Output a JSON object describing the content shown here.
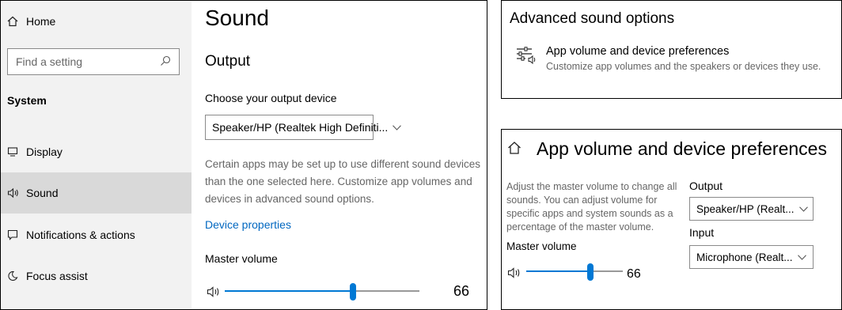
{
  "settings": {
    "sidebar": {
      "home_label": "Home",
      "search_placeholder": "Find a setting",
      "section_label": "System",
      "items": [
        {
          "label": "Display",
          "icon": "monitor-icon"
        },
        {
          "label": "Sound",
          "icon": "speaker-icon",
          "active": true
        },
        {
          "label": "Notifications & actions",
          "icon": "notification-icon"
        },
        {
          "label": "Focus assist",
          "icon": "moon-icon"
        }
      ]
    },
    "main": {
      "title": "Sound",
      "section": "Output",
      "device_label": "Choose your output device",
      "device_value": "Speaker/HP (Realtek High Definiti...",
      "note": "Certain apps may be set up to use different sound devices than the one selected here. Customize app volumes and devices in advanced sound options.",
      "device_properties_link": "Device properties",
      "master_label": "Master volume",
      "master_value": "66",
      "master_fraction": 0.66
    }
  },
  "advanced": {
    "title": "Advanced sound options",
    "item_title": "App volume and device preferences",
    "item_subtitle": "Customize app volumes and the speakers or devices they use.",
    "item_icon": "sliders-speaker-icon"
  },
  "app_volume": {
    "title": "App volume and device preferences",
    "description": "Adjust the master volume to change all sounds. You can adjust volume for specific apps and system sounds as a percentage of the master volume.",
    "master_label": "Master volume",
    "master_value": "66",
    "master_fraction": 0.66,
    "output_label": "Output",
    "output_value": "Speaker/HP (Realt...",
    "input_label": "Input",
    "input_value": "Microphone (Realt..."
  },
  "colors": {
    "accent": "#0078d4",
    "link": "#0067c0",
    "sidebar_bg": "#f2f2f2",
    "sidebar_active": "#d9d9d9"
  }
}
